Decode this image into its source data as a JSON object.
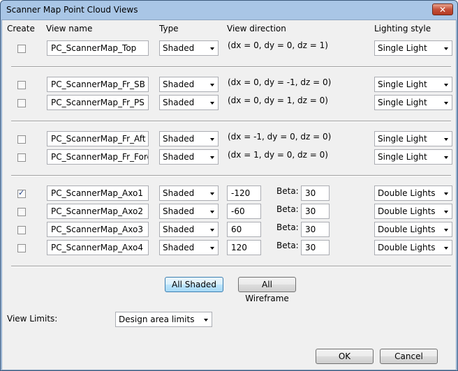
{
  "window": {
    "title": "Scanner Map Point Cloud Views",
    "close_glyph": "✕"
  },
  "headers": {
    "create": "Create",
    "view_name": "View name",
    "type": "Type",
    "view_direction": "View direction",
    "lighting_style": "Lighting style"
  },
  "rows": [
    {
      "checked": false,
      "name": "PC_ScannerMap_Top",
      "type": "Shaded",
      "direction": "(dx =  0, dy =  0, dz = 1)",
      "lighting": "Single Light"
    },
    {
      "checked": false,
      "name": "PC_ScannerMap_Fr_SB",
      "type": "Shaded",
      "direction": "(dx =  0, dy = -1, dz = 0)",
      "lighting": "Single Light"
    },
    {
      "checked": false,
      "name": "PC_ScannerMap_Fr_PS",
      "type": "Shaded",
      "direction": "(dx =  0, dy =  1, dz = 0)",
      "lighting": "Single Light"
    },
    {
      "checked": false,
      "name": "PC_ScannerMap_Fr_Aft",
      "type": "Shaded",
      "direction": "(dx = -1, dy =  0, dz = 0)",
      "lighting": "Single Light"
    },
    {
      "checked": false,
      "name": "PC_ScannerMap_Fr_Fore",
      "type": "Shaded",
      "direction": "(dx =  1, dy =  0, dz = 0)",
      "lighting": "Single Light"
    },
    {
      "checked": true,
      "name": "PC_ScannerMap_Axo1",
      "type": "Shaded",
      "alpha": "-120",
      "beta_label": "Beta:",
      "beta": "30",
      "lighting": "Double Lights"
    },
    {
      "checked": false,
      "name": "PC_ScannerMap_Axo2",
      "type": "Shaded",
      "alpha": "-60",
      "beta_label": "Beta:",
      "beta": "30",
      "lighting": "Double Lights"
    },
    {
      "checked": false,
      "name": "PC_ScannerMap_Axo3",
      "type": "Shaded",
      "alpha": "60",
      "beta_label": "Beta:",
      "beta": "30",
      "lighting": "Double Lights"
    },
    {
      "checked": false,
      "name": "PC_ScannerMap_Axo4",
      "type": "Shaded",
      "alpha": "120",
      "beta_label": "Beta:",
      "beta": "30",
      "lighting": "Double Lights"
    }
  ],
  "buttons": {
    "all_shaded": "All Shaded",
    "all_wireframe": "All Wireframe",
    "ok": "OK",
    "cancel": "Cancel"
  },
  "view_limits": {
    "label": "View Limits:",
    "value": "Design area limits"
  }
}
